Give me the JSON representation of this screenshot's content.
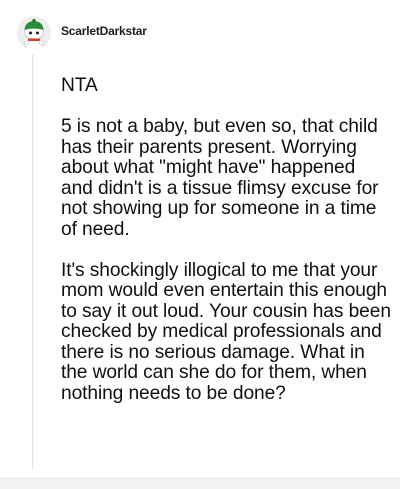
{
  "comment": {
    "username": "ScarletDarkstar",
    "avatar_icon": "snoo-avatar-icon",
    "accent_color": "#2e8b3a",
    "paragraphs": [
      "NTA",
      "5 is not a baby, but even so, that child has their parents present. Worrying about what \"might have\" happened and didn't is a tissue flimsy excuse for not showing up for someone in a time of need.",
      "It's shockingly illogical to me that your mom would even entertain this enough to say it out loud. Your cousin has been checked by medical professionals and there is no serious damage. What in the world can she do for them, when nothing needs to be done?"
    ]
  }
}
